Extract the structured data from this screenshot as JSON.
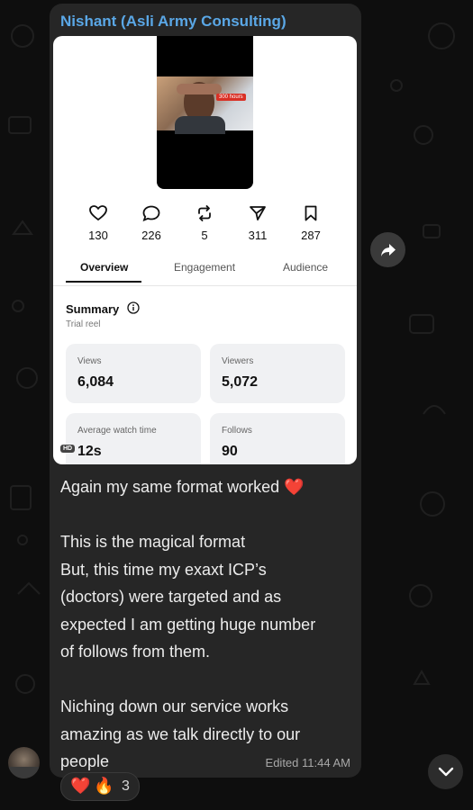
{
  "message": {
    "sender": "Nishant (Asli Army Consulting)",
    "text": "Again my same format worked ❤️\n\nThis is the magical format\nBut, this time  my exaxt ICP’s\n(doctors) were targeted and as\nexpected I am getting huge number\nof follows from them.\n\nNiching down our service works\namazing as we talk directly to our\npeople",
    "edited_label": "Edited",
    "time": "11:44 AM",
    "reactions": {
      "emoji1": "❤️",
      "emoji2": "🔥",
      "count": "3"
    }
  },
  "screenshot": {
    "reel_tag": "300 hours",
    "stats": [
      {
        "icon": "heart-icon",
        "value": "130"
      },
      {
        "icon": "comment-icon",
        "value": "226"
      },
      {
        "icon": "repost-icon",
        "value": "5"
      },
      {
        "icon": "share-icon",
        "value": "311"
      },
      {
        "icon": "bookmark-icon",
        "value": "287"
      }
    ],
    "tabs": [
      "Overview",
      "Engagement",
      "Audience"
    ],
    "active_tab": "Overview",
    "summary_title": "Summary",
    "summary_subtitle": "Trial reel",
    "cards": [
      {
        "label": "Views",
        "value": "6,084"
      },
      {
        "label": "Viewers",
        "value": "5,072"
      },
      {
        "label": "Average watch time",
        "value": "12s"
      },
      {
        "label": "Follows",
        "value": "90"
      }
    ],
    "hd_badge": "HD"
  },
  "colors": {
    "background": "#0e0e0e",
    "bubble": "#262626",
    "sender": "#5aa7e6",
    "text": "#ececec",
    "meta": "#a8a8a8"
  }
}
